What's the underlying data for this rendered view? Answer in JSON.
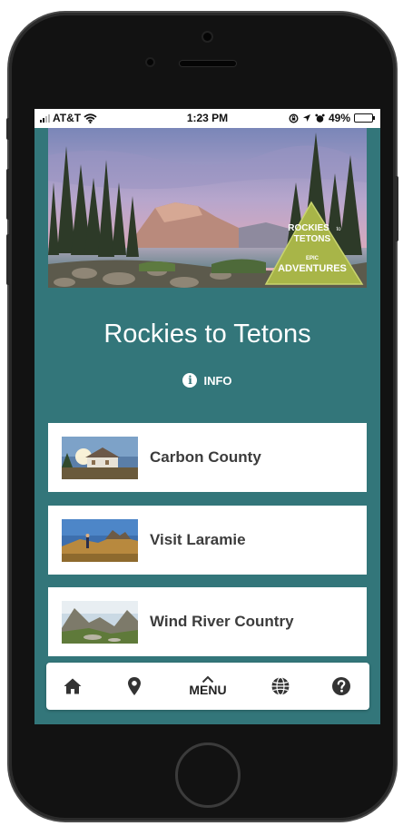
{
  "status_bar": {
    "carrier": "AT&T",
    "time": "1:23 PM",
    "battery": "49%",
    "battery_level": 0.49
  },
  "hero": {
    "logo_line1": "ROCKIES",
    "logo_to": "to",
    "logo_line2": "TETONS",
    "logo_epic": "EPIC",
    "logo_line3": "ADVENTURES"
  },
  "app": {
    "title": "Rockies to Tetons",
    "info_label": "INFO"
  },
  "cards": [
    {
      "label": "Carbon County"
    },
    {
      "label": "Visit Laramie"
    },
    {
      "label": "Wind River Country"
    }
  ],
  "nav": {
    "menu_label": "MENU",
    "items": [
      "home-icon",
      "map-pin-icon",
      "chevron-up-icon",
      "globe-icon",
      "help-icon"
    ]
  },
  "colors": {
    "screen_background": "#33767a",
    "card_background": "#ffffff",
    "card_text": "#3c3c3c",
    "logo_green": "#a8b548"
  }
}
